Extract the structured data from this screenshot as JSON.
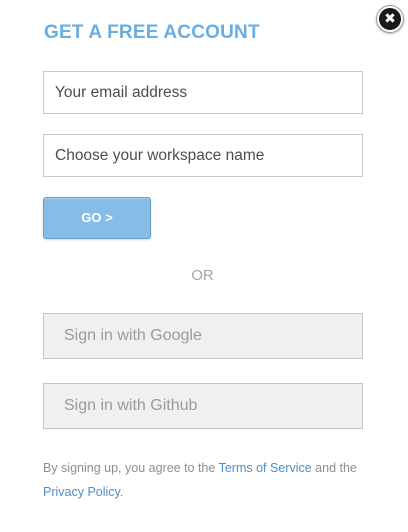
{
  "close": {
    "glyph": "✖",
    "icon": "close-icon"
  },
  "title": "GET A FREE ACCOUNT",
  "form": {
    "email_placeholder": "Your email address",
    "email_value": "",
    "workspace_placeholder": "Choose your workspace name",
    "workspace_value": "",
    "go_label": "GO >"
  },
  "divider_label": "OR",
  "social": {
    "google_label": "Sign in with Google",
    "github_label": "Sign in with Github"
  },
  "terms": {
    "prefix": "By signing up, you agree to the ",
    "tos_link": "Terms of Service",
    "middle": " and the ",
    "privacy_link": "Privacy Policy",
    "suffix": "."
  },
  "colors": {
    "title": "#6aaee0",
    "go_button": "#85bde6",
    "link": "#4a8fcc"
  }
}
